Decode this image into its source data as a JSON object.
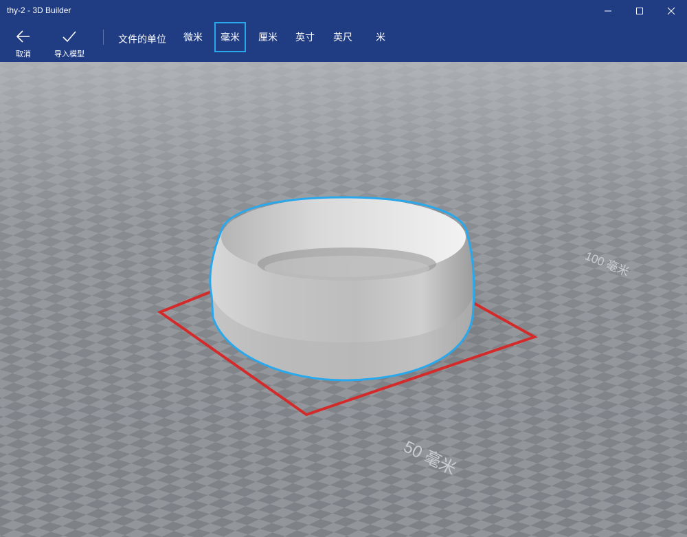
{
  "window": {
    "title": "thy-2 - 3D Builder"
  },
  "toolbar": {
    "cancel_label": "取消",
    "import_label": "导入模型",
    "unit_caption": "文件的单位",
    "units": [
      "微米",
      "毫米",
      "厘米",
      "英寸",
      "英尺",
      "米"
    ],
    "selected_unit": "毫米"
  },
  "viewport": {
    "dimension_labels": [
      "100 毫米",
      "50 毫米"
    ]
  },
  "colors": {
    "accent": "#29a8ec",
    "chrome": "#203c83",
    "bounding_box": "#d32a2a",
    "floor_light": "#92969b",
    "floor_dark": "#7e8287"
  },
  "icons": [
    "back-arrow-icon",
    "checkmark-icon",
    "minimize-icon",
    "maximize-icon",
    "close-icon"
  ]
}
